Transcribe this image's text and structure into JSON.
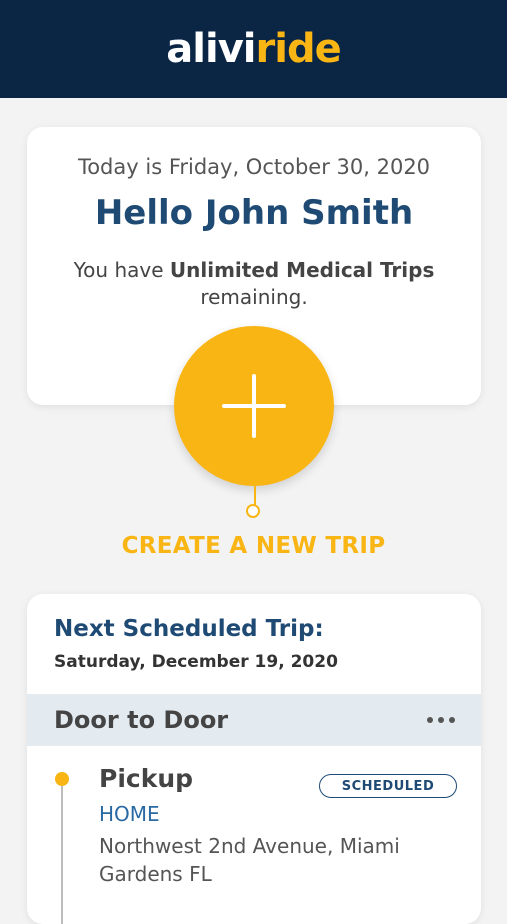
{
  "header": {
    "logo_part1": "alivi",
    "logo_part2": "ride",
    "background_color": "#0b2545",
    "accent_color": "#f8b514"
  },
  "greeting": {
    "date_text": "Today is Friday, October 30, 2020",
    "hello_text": "Hello John Smith",
    "remaining_prefix": "You have ",
    "remaining_bold": "Unlimited Medical Trips",
    "remaining_suffix": "remaining."
  },
  "create_trip": {
    "icon": "plus-icon",
    "label": "CREATE A NEW TRIP"
  },
  "next_trip": {
    "title": "Next Scheduled Trip:",
    "date": "Saturday, December 19, 2020",
    "service_type": "Door to Door",
    "more_icon": "more-horizontal-icon",
    "pickup": {
      "label": "Pickup",
      "status": "SCHEDULED",
      "place_name": "HOME",
      "address": "Northwest 2nd Avenue, Miami Gardens FL"
    }
  }
}
